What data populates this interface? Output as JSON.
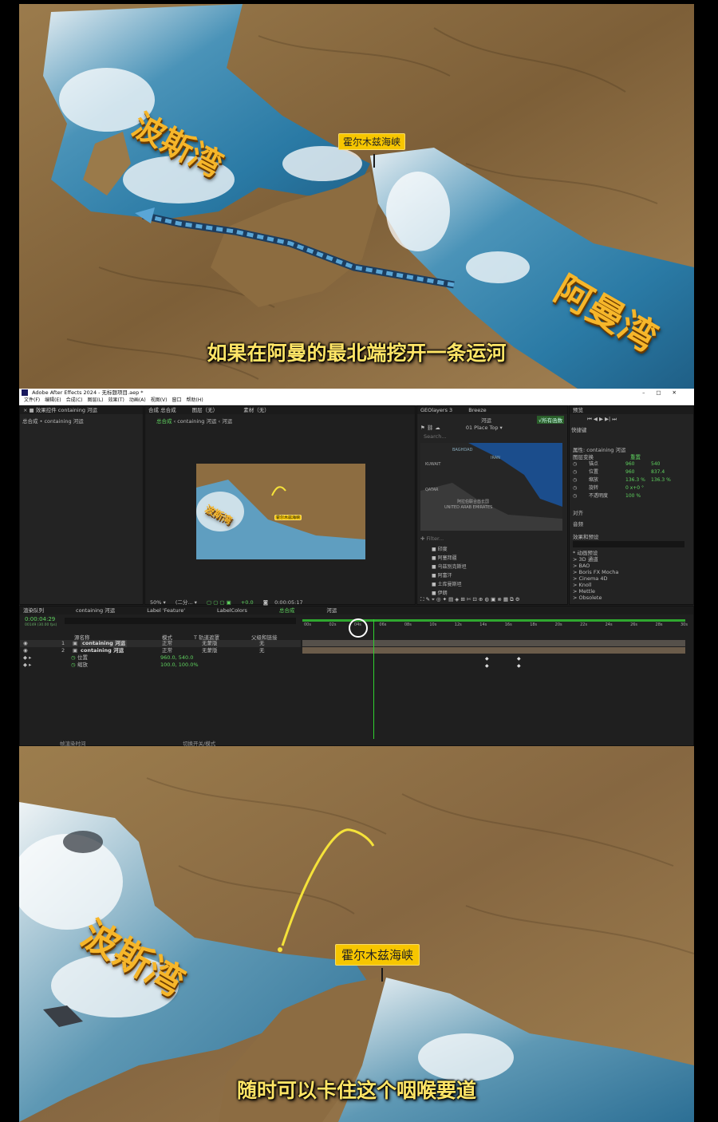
{
  "top_video": {
    "big_label_persian_gulf": "波斯湾",
    "big_label_gulf_of_oman": "阿曼湾",
    "strait_tag": "霍尔木兹海峡",
    "subtitle": "如果在阿曼的最北端挖开一条运河"
  },
  "ae": {
    "window_title": "Adobe After Effects 2024 - 无标题项目.aep *",
    "menu": [
      "文件(F)",
      "编辑(E)",
      "合成(C)",
      "图层(L)",
      "效果(T)",
      "动画(A)",
      "视图(V)",
      "窗口",
      "帮助(H)"
    ],
    "effects_panel": {
      "tab": "效果控件 containing 河运",
      "breadcrumb": "总合成 • containing 河运"
    },
    "comp_panel": {
      "tab": "合成 总合成",
      "tab2": "图层（无）",
      "tab3": "素材（无）",
      "crumbs": [
        "总合成",
        "containing 河运",
        "河运"
      ],
      "zoom": "50%",
      "resolution": "(二分...",
      "exposure": "+0.0",
      "time": "0:00:05:17",
      "preview_tag": "霍尔木兹海峡",
      "preview_label": "波斯湾"
    },
    "geo_panel": {
      "tabs": [
        "GEOlayers 3",
        "Breeze"
      ],
      "layer_name": "河运",
      "btn_label": "√所有函数",
      "place_mode": "01 Place Top ▾",
      "search_placeholder": "Search...",
      "map_labels": [
        "BAGHDAD",
        "IRAN",
        "KUWAIT",
        "QATAR",
        "阿拉伯联合酋长国",
        "UNITED ARAB EMIRATES",
        "QATAR"
      ],
      "filter_placeholder": "Filter...",
      "layers": [
        "印度",
        "阿塞拜疆",
        "乌兹别克斯坦",
        "阿富汗",
        "土库曼斯坦",
        "伊朗"
      ]
    },
    "right_panel": {
      "preview_tab": "预览",
      "shortcut": "快捷键",
      "props_title": "属性: containing 河运",
      "layer_transform": "图层变换",
      "reset": "重置",
      "props": [
        {
          "name": "锚点",
          "v1": "960",
          "v2": "540"
        },
        {
          "name": "位置",
          "v1": "960",
          "v2": "837.4"
        },
        {
          "name": "缩放",
          "v1": "136.3 %",
          "v2": "136.3 %"
        },
        {
          "name": "旋转",
          "v1": "0 x+0 °",
          "v2": ""
        },
        {
          "name": "不透明度",
          "v1": "100 %",
          "v2": ""
        }
      ],
      "align": "对齐",
      "audio": "音频",
      "effects_presets": "效果和预设",
      "fx_list": [
        "* 动画预设",
        "> 3D 通道",
        "> BAO",
        "> Boris FX Mocha",
        "> Cinema 4D",
        "> Knoll",
        "> Mettle",
        "> Obsolete"
      ]
    },
    "timeline": {
      "tabs": [
        "渲染队列",
        "containing 河运",
        "Label 'Feature'",
        "LabelColors",
        "总合成",
        "河运"
      ],
      "timecode": "0:00:04:29",
      "fps": "00149 (30.00 fps)",
      "col_source": "源名称",
      "col_mode": "模式",
      "col_trkmat": "T 轨道遮罩",
      "col_parent": "父级和链接",
      "layers": [
        {
          "num": "1",
          "name": "containing 河运",
          "mode": "正常",
          "matte": "无蒙版",
          "parent": "无"
        },
        {
          "num": "2",
          "name": "containing 河运",
          "mode": "正常",
          "matte": "无蒙版",
          "parent": "无"
        }
      ],
      "sub_props": [
        {
          "name": "位置",
          "value": "960.0, 540.0"
        },
        {
          "name": "缩放",
          "value": "100.0, 100.0%"
        }
      ],
      "ruler": [
        "00s",
        "02s",
        "04s",
        "06s",
        "08s",
        "10s",
        "12s",
        "14s",
        "16s",
        "18s",
        "20s",
        "22s",
        "24s",
        "26s",
        "28s",
        "30s"
      ],
      "footer_left": "帧渲染时间",
      "footer_mid": "切换开关/模式"
    }
  },
  "bottom_video": {
    "big_label_persian_gulf": "波斯湾",
    "strait_tag": "霍尔木兹海峡",
    "subtitle": "随时可以卡住这个咽喉要道"
  },
  "colors": {
    "accent_green": "#5fd35f",
    "tag_yellow": "#f7c600",
    "label_orange": "#f6b62a",
    "subtitle_yellow": "#ffe566",
    "ae_bg": "#1d1d1d",
    "geo_map_blue": "#1b4d8c"
  }
}
